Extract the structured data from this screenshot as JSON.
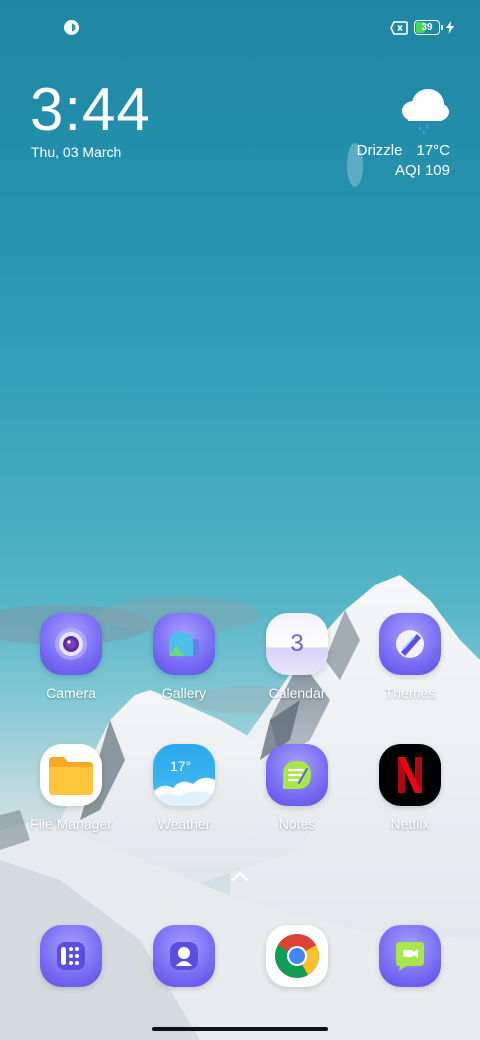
{
  "status_bar": {
    "battery_percent": "39",
    "battery_level": 0.39,
    "charging": true,
    "left_icon": "notification-app-icon",
    "sim_icon": "no-sim-icon"
  },
  "clock": {
    "time": "3:44",
    "date": "Thu, 03 March"
  },
  "weather_widget": {
    "icon": "drizzle-cloud-icon",
    "condition": "Drizzle",
    "temperature": "17°C",
    "aqi": "AQI 109"
  },
  "apps": [
    {
      "label": "Camera",
      "icon": "camera-icon"
    },
    {
      "label": "Gallery",
      "icon": "gallery-icon"
    },
    {
      "label": "Calendar",
      "icon": "calendar-icon",
      "badge_text": "3"
    },
    {
      "label": "Themes",
      "icon": "themes-icon"
    },
    {
      "label": "File Manager",
      "icon": "folder-icon"
    },
    {
      "label": "Weather",
      "icon": "weather-icon",
      "badge_text": "17°"
    },
    {
      "label": "Notes",
      "icon": "notes-icon"
    },
    {
      "label": "Netflix",
      "icon": "netflix-icon"
    }
  ],
  "dock": [
    {
      "icon": "phone-dialer-icon"
    },
    {
      "icon": "contacts-icon"
    },
    {
      "icon": "chrome-icon"
    },
    {
      "icon": "messages-icon"
    }
  ],
  "colors": {
    "accent_purple": "#6f63f0",
    "battery_green": "#3ddc5a",
    "netflix_red": "#e50914"
  }
}
